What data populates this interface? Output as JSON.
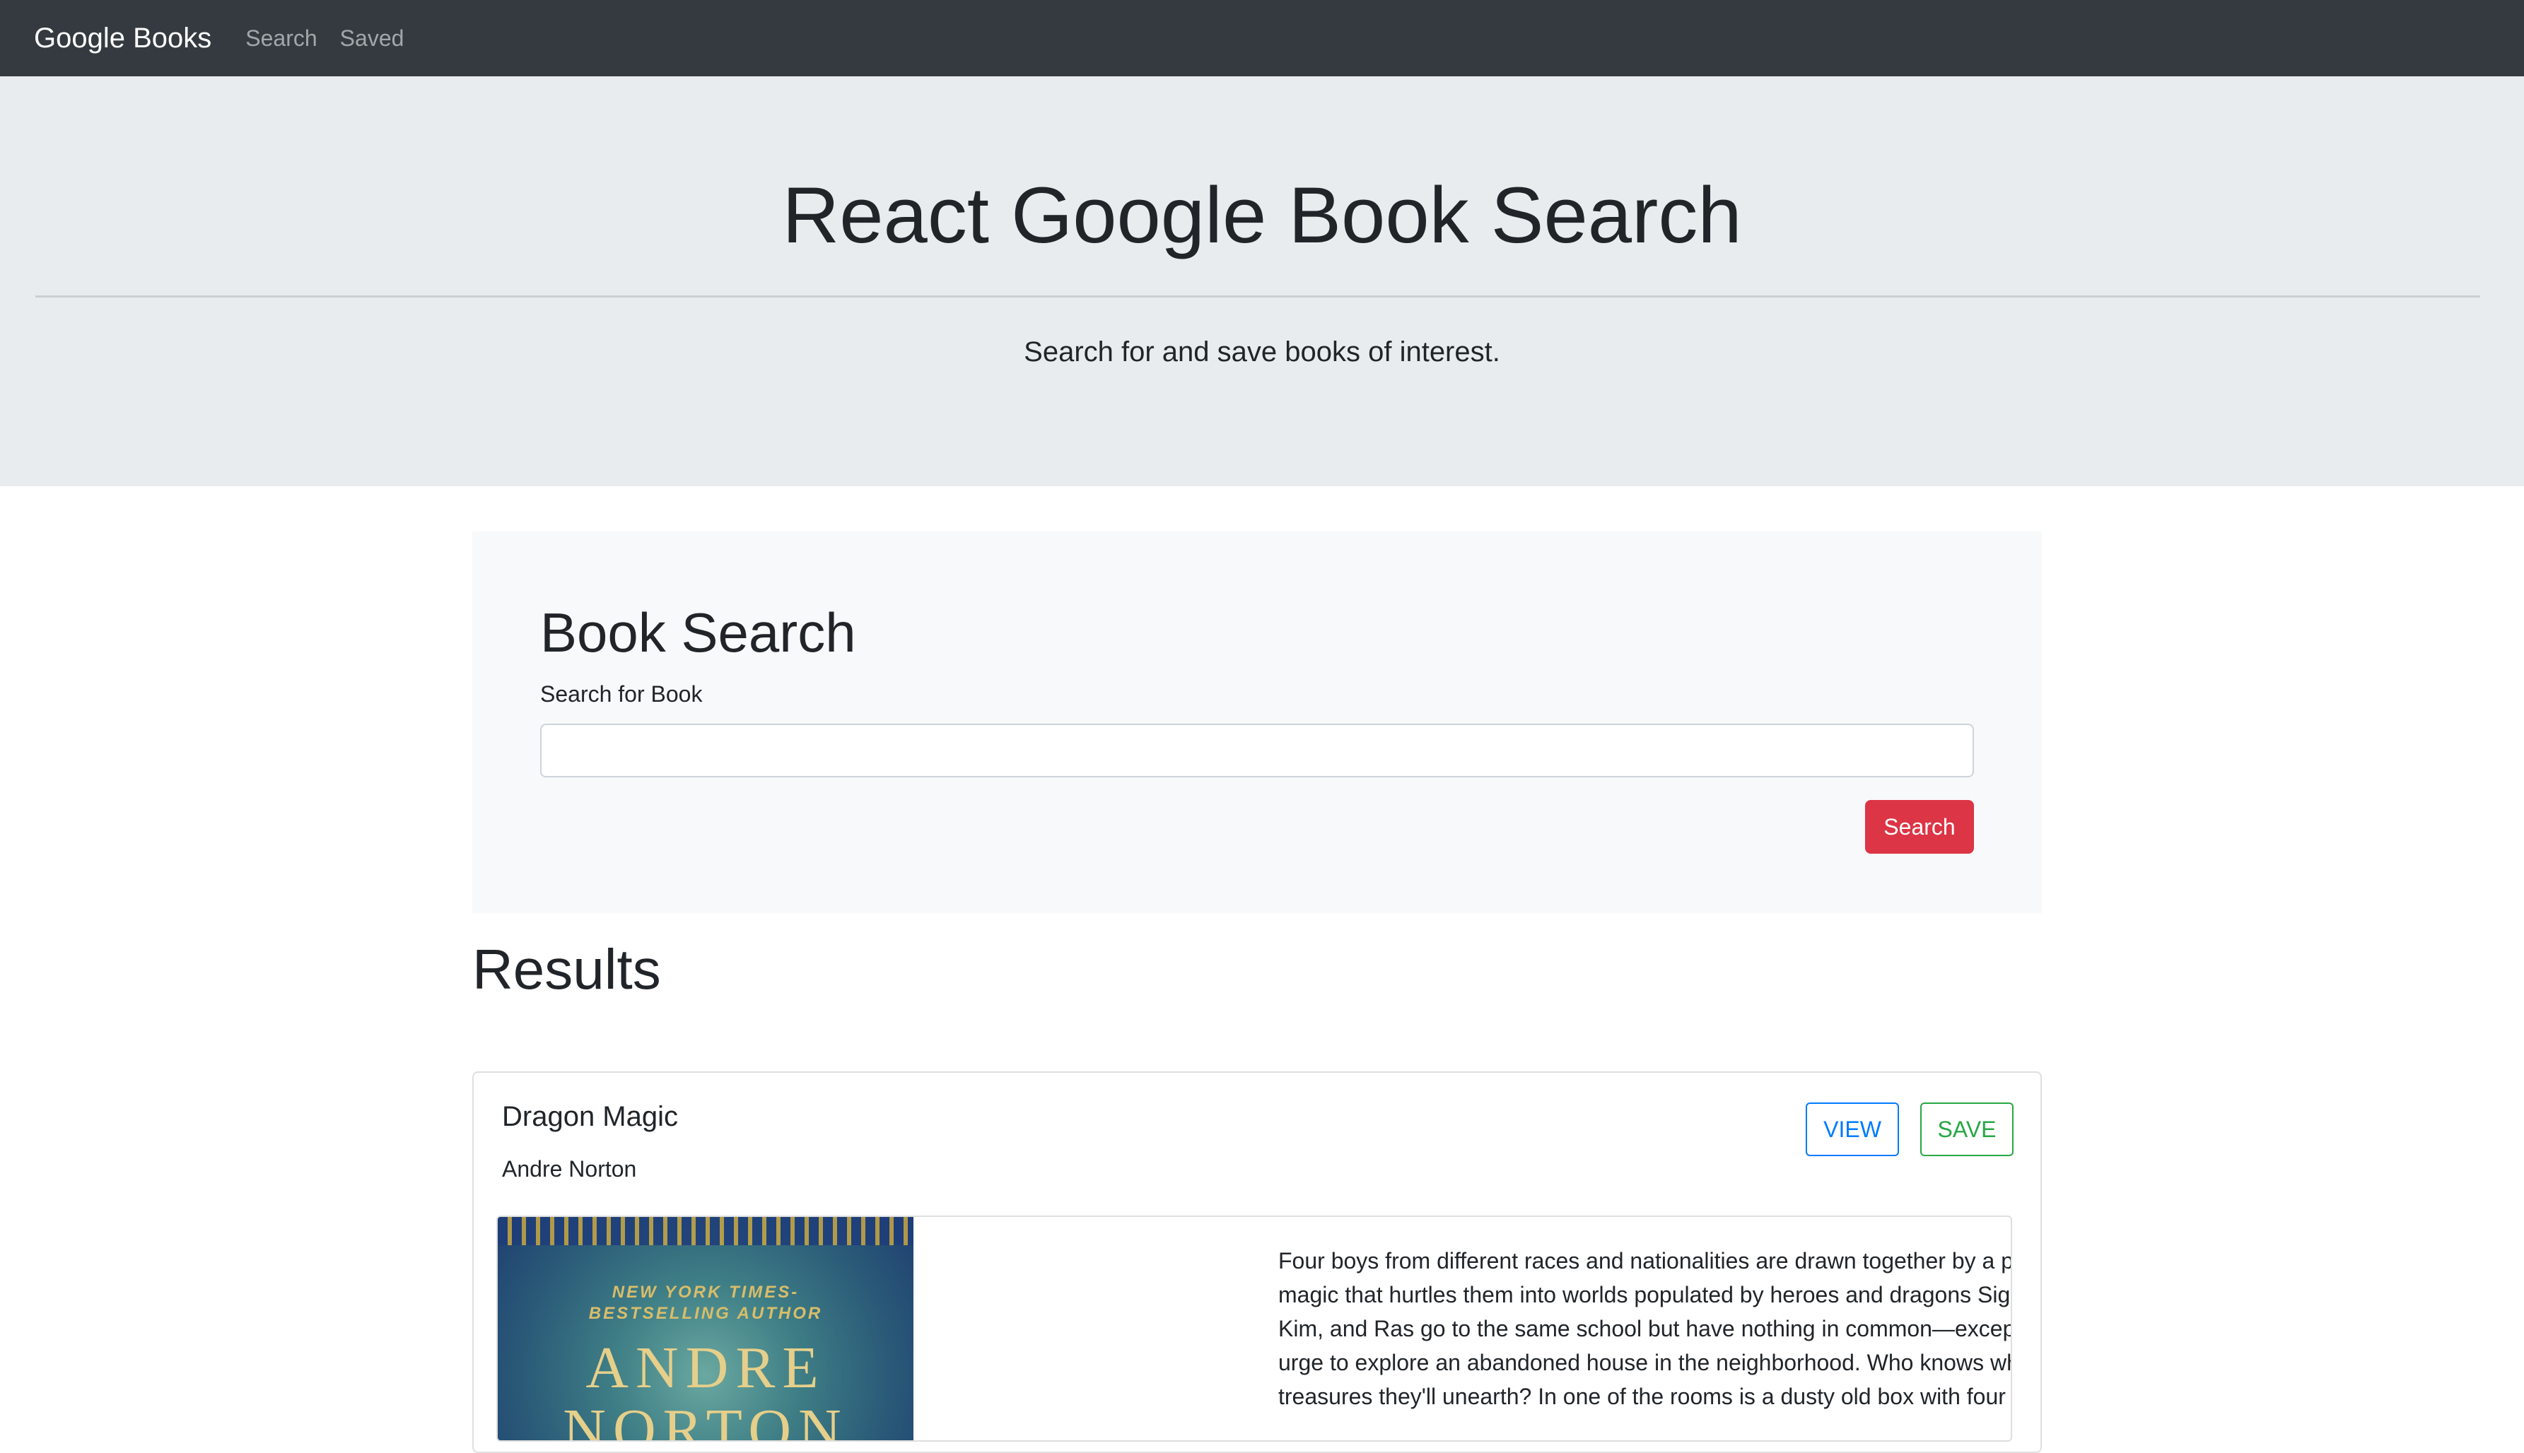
{
  "navbar": {
    "brand": "Google Books",
    "links": [
      {
        "label": "Search"
      },
      {
        "label": "Saved"
      }
    ]
  },
  "jumbotron": {
    "title": "React Google Book Search",
    "subtitle": "Search for and save books of interest."
  },
  "search_panel": {
    "title": "Book Search",
    "field_label": "Search for Book",
    "input_value": "",
    "button_label": "Search"
  },
  "results": {
    "heading": "Results",
    "items": [
      {
        "title": "Dragon Magic",
        "author": "Andre Norton",
        "view_label": "VIEW",
        "save_label": "SAVE",
        "cover_tagline": "NEW YORK TIMES-\nBESTSELLING AUTHOR",
        "cover_author": "ANDRE\nNORTON",
        "description": "Four boys from different races and nationalities are drawn together by a potent magic that hurtles them into worlds populated by heroes and dragons Sig, Artie, Kim, and Ras go to the same school but have nothing in common—except for the urge to explore an abandoned house in the neighborhood. Who knows what treasures they'll unearth? In one of the rooms is a dusty old box with four"
      }
    ]
  },
  "colors": {
    "navbar_bg": "#343a40",
    "jumbotron_bg": "#e9ecef",
    "panel_bg": "#f8f9fa",
    "search_button": "#dc3545",
    "view_button": "#007bff",
    "save_button": "#28a745"
  }
}
